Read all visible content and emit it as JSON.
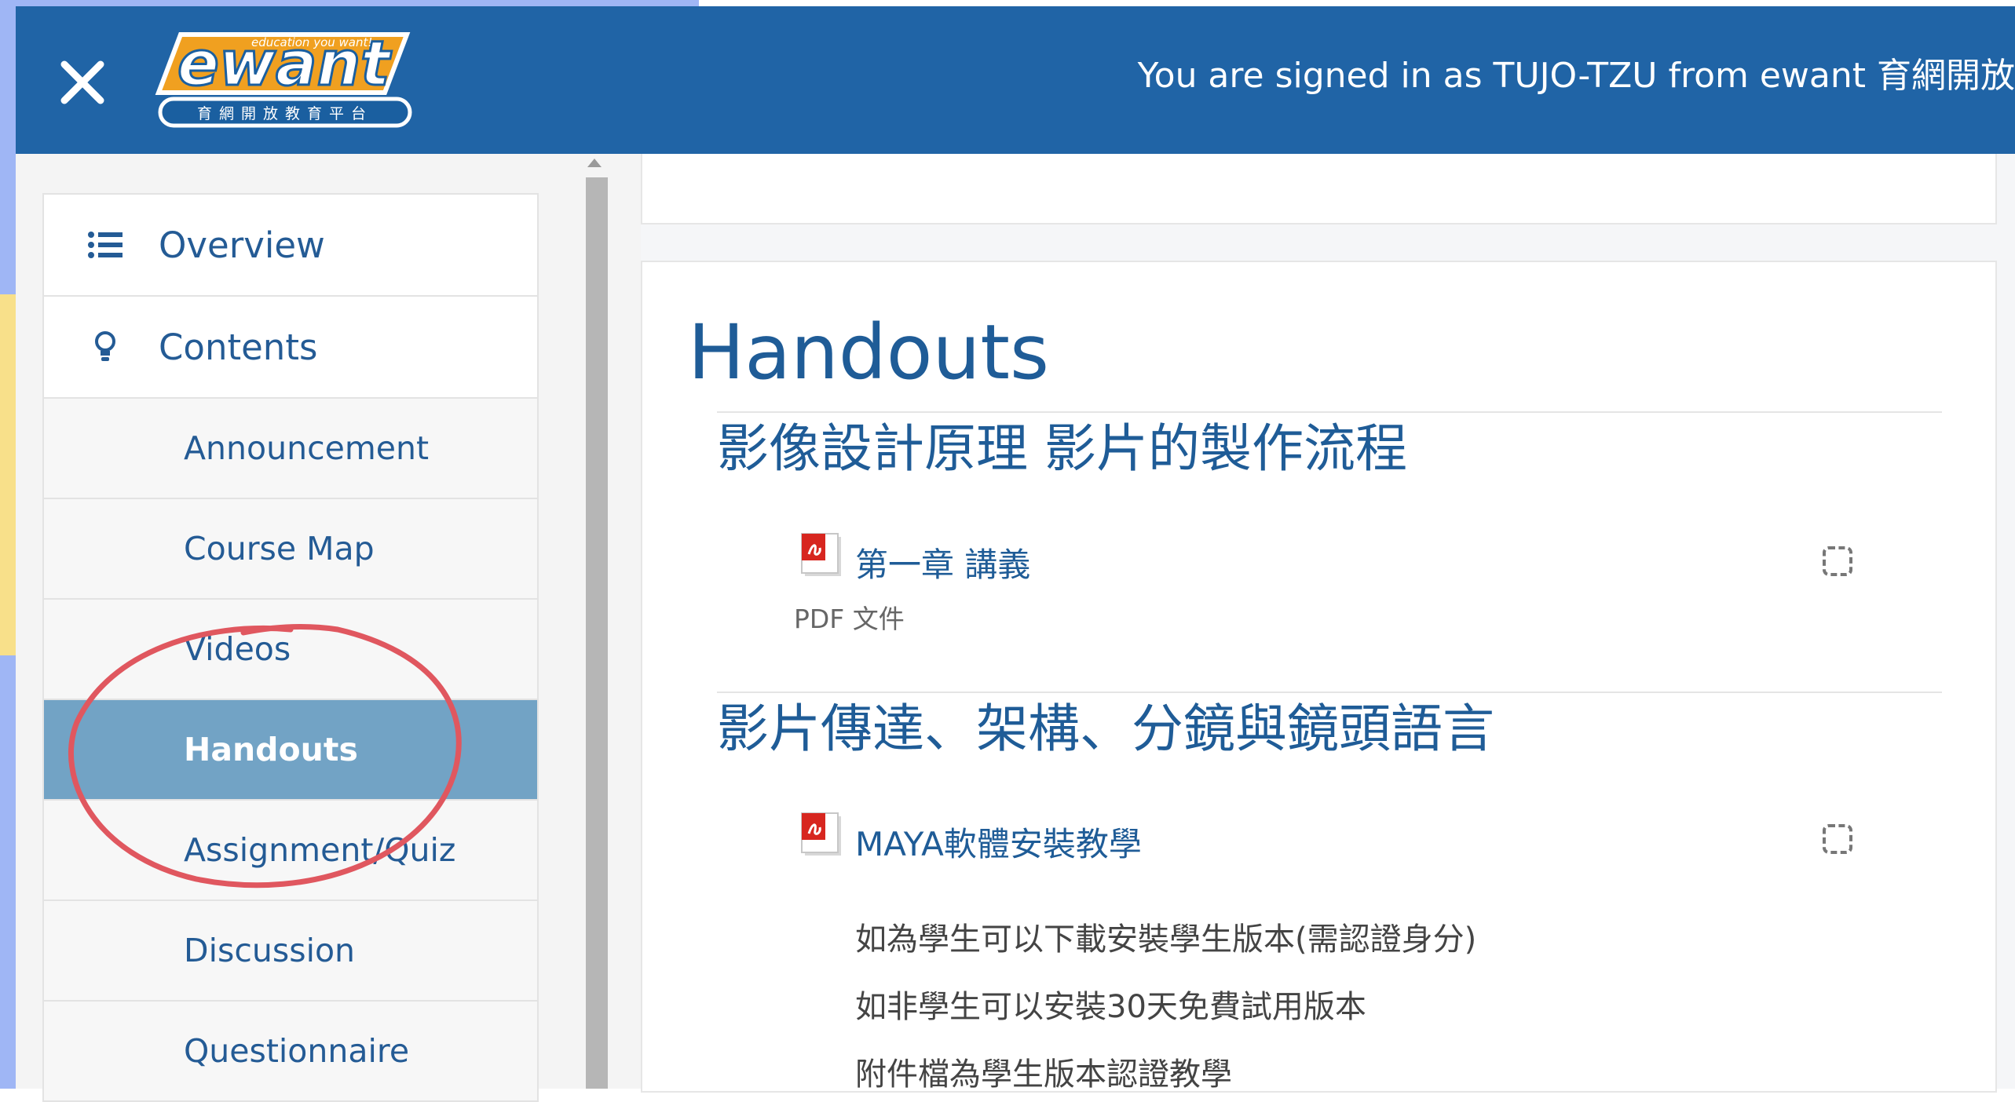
{
  "header": {
    "close_icon": "close-icon",
    "logo": {
      "main_text": "ewant",
      "tagline": "education you want!",
      "subtitle": "育網開放教育平台"
    },
    "signin_text": "You are signed in as TUJO-TZU from ewant 育網開放"
  },
  "sidebar": {
    "items": [
      {
        "label": "Overview",
        "icon": "list-icon"
      },
      {
        "label": "Contents",
        "icon": "lightbulb-icon"
      },
      {
        "label": "Announcement"
      },
      {
        "label": "Course Map"
      },
      {
        "label": "Videos"
      },
      {
        "label": "Handouts",
        "active": true
      },
      {
        "label": "Assignment/Quiz"
      },
      {
        "label": "Discussion"
      },
      {
        "label": "Questionnaire"
      }
    ]
  },
  "main": {
    "title": "Handouts",
    "sections": [
      {
        "title": "影像設計原理 影片的製作流程",
        "activities": [
          {
            "label": "第一章 講義",
            "type": "PDF 文件",
            "icon": "pdf-icon"
          }
        ]
      },
      {
        "title": "影片傳達、架構、分鏡與鏡頭語言",
        "activities": [
          {
            "label": "MAYA軟體安裝教學",
            "icon": "pdf-icon"
          }
        ],
        "description": [
          "如為學生可以下載安裝學生版本(需認證身分)",
          "如非學生可以安裝30天免費試用版本",
          "附件檔為學生版本認證教學"
        ]
      }
    ]
  },
  "colors": {
    "header_bg": "#2064a6",
    "accent": "#1f5c97",
    "active_item_bg": "#72a3c5",
    "annotation": "#e0575f"
  }
}
